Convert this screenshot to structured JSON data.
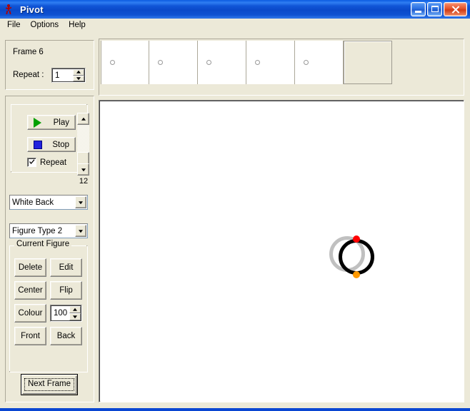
{
  "window": {
    "title": "Pivot",
    "icon": "stick-figure-icon",
    "buttons": {
      "minimize": "minimize-icon",
      "maximize": "maximize-icon",
      "close": "close-icon"
    },
    "titlebar_color": "#0a46d2",
    "client_color": "#ece9d8"
  },
  "menu": {
    "items": [
      {
        "label": "File"
      },
      {
        "label": "Options"
      },
      {
        "label": "Help"
      }
    ]
  },
  "frame_info": {
    "frame_label": "Frame 6",
    "repeat_label": "Repeat :",
    "repeat_value": "1"
  },
  "playback": {
    "play_label": "Play",
    "stop_label": "Stop",
    "repeat_label": "Repeat",
    "repeat_checked": true,
    "frame_count": "12",
    "play_icon_color": "#00a000",
    "stop_icon_color": "#2222dd"
  },
  "options": {
    "background_selected": "White Back",
    "figure_type_selected": "Figure Type 2"
  },
  "current_figure": {
    "legend": "Current Figure",
    "delete_label": "Delete",
    "edit_label": "Edit",
    "center_label": "Center",
    "flip_label": "Flip",
    "colour_label": "Colour",
    "colour_value": "100",
    "front_label": "Front",
    "back_label": "Back"
  },
  "next_frame": {
    "label": "Next Frame"
  },
  "frames_strip": {
    "cells": [
      {
        "name": "frame-thumb-1",
        "has_figure": true,
        "current": false
      },
      {
        "name": "frame-thumb-2",
        "has_figure": true,
        "current": false
      },
      {
        "name": "frame-thumb-3",
        "has_figure": true,
        "current": false
      },
      {
        "name": "frame-thumb-4",
        "has_figure": true,
        "current": false
      },
      {
        "name": "frame-thumb-5",
        "has_figure": true,
        "current": false
      },
      {
        "name": "frame-thumb-6",
        "has_figure": false,
        "current": true
      }
    ]
  },
  "canvas": {
    "background": "#ffffff",
    "figure": {
      "body_color": "#000000",
      "top_joint_color": "#ff0000",
      "bottom_joint_color": "#ff9900"
    },
    "ghost": {
      "color": "#c0c0c0"
    }
  }
}
